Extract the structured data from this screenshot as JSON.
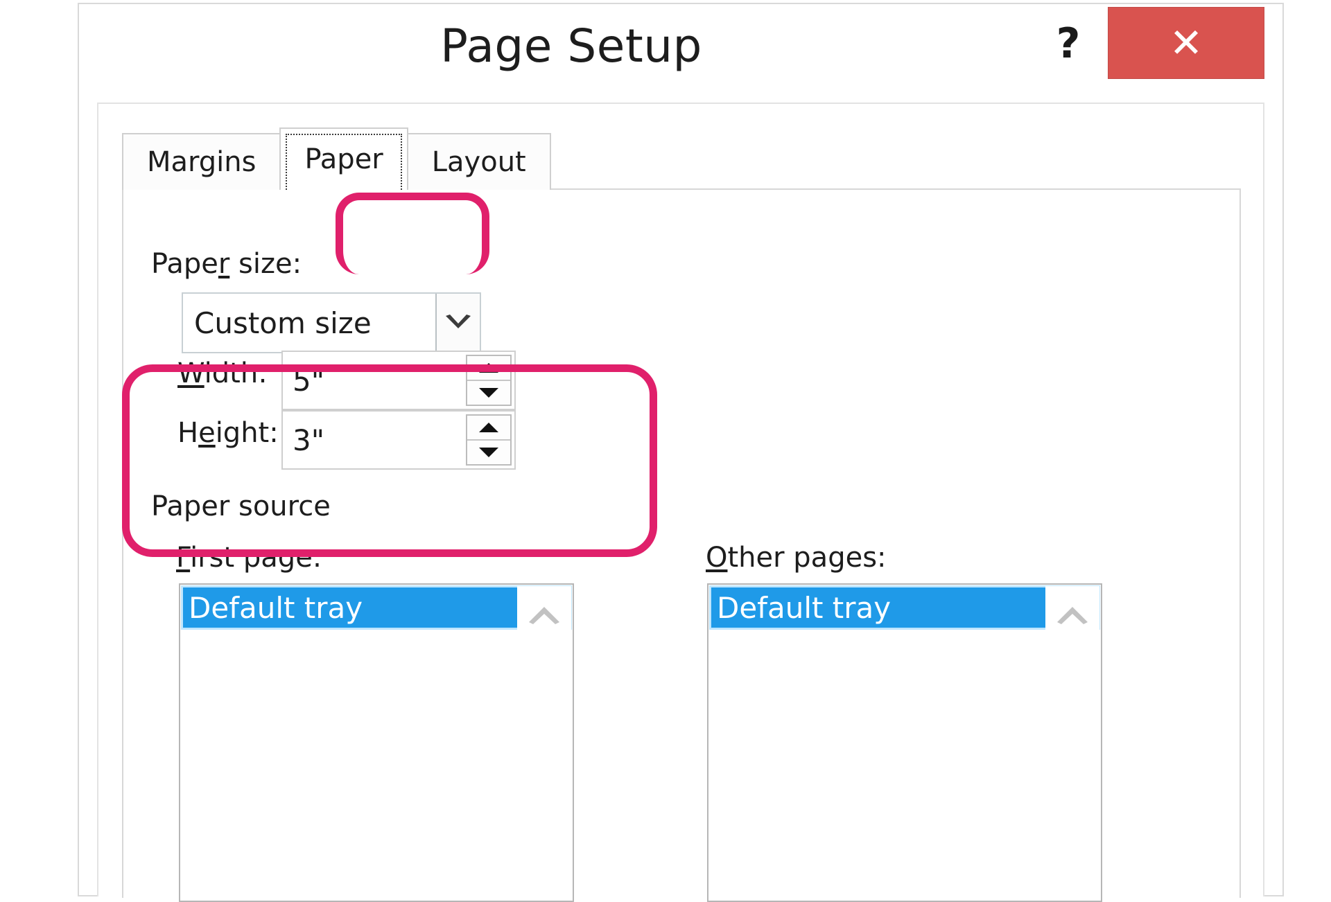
{
  "window": {
    "title": "Page Setup",
    "help_label": "?",
    "close_label": "✕"
  },
  "tabs": [
    {
      "label": "Margins",
      "selected": false
    },
    {
      "label": "Paper",
      "selected": true
    },
    {
      "label": "Layout",
      "selected": false
    }
  ],
  "paper_size": {
    "section_label": "Paper size:",
    "section_label_pre": "Pape",
    "section_label_accel": "r",
    "section_label_post": " size:",
    "selected_value": "Custom size",
    "dropdown_icon": "chevron-down-icon",
    "width": {
      "label_pre": "",
      "label_accel": "W",
      "label_post": "idth:",
      "label": "Width:",
      "value": "5\""
    },
    "height": {
      "label_pre": "H",
      "label_accel": "e",
      "label_post": "ight:",
      "label": "Height:",
      "value": "3\""
    },
    "spinner_up_icon": "triangle-up-icon",
    "spinner_down_icon": "triangle-down-icon"
  },
  "paper_source": {
    "section_label": "Paper source",
    "first_page": {
      "label": "First page:",
      "label_accel": "F",
      "label_post": "irst page:",
      "items": [
        {
          "label": "Default tray",
          "selected": true
        }
      ],
      "scroll_icon": "chevron-up-icon"
    },
    "other_pages": {
      "label": "Other pages:",
      "label_accel": "O",
      "label_post": "ther pages:",
      "items": [
        {
          "label": "Default tray",
          "selected": true
        }
      ],
      "scroll_icon": "chevron-up-icon"
    }
  },
  "annotations": {
    "highlight_color": "#e0206b",
    "highlight_tab": "Paper",
    "highlight_group": "paper-size-fields"
  },
  "colors": {
    "close_button": "#d9534f",
    "selection_blue": "#1f9ae8",
    "highlight_pink": "#e0206b"
  }
}
